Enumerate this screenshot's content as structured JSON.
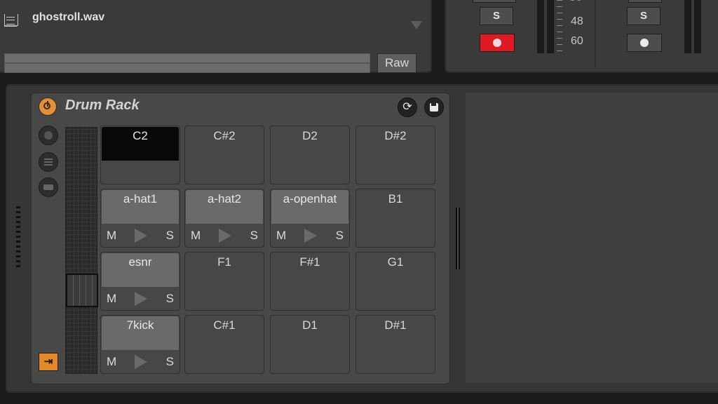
{
  "clip": {
    "sample_name": "ghostroll.wav",
    "raw_label": "Raw"
  },
  "mixer": {
    "solo_label": "S",
    "volume_marks": [
      "48",
      "60"
    ],
    "record_armed_color": "#e01a22"
  },
  "drum_rack": {
    "title": "Drum Rack",
    "hotswap_label": "⇥"
  },
  "pads": [
    {
      "note": "C2",
      "filled": false,
      "selected": true
    },
    {
      "note": "C#2",
      "filled": false,
      "selected": false
    },
    {
      "note": "D2",
      "filled": false,
      "selected": false
    },
    {
      "note": "D#2",
      "filled": false,
      "selected": false
    },
    {
      "note": "a-hat1",
      "filled": true,
      "selected": false
    },
    {
      "note": "a-hat2",
      "filled": true,
      "selected": false
    },
    {
      "note": "a-openhat",
      "filled": true,
      "selected": false
    },
    {
      "note": "B1",
      "filled": false,
      "selected": false
    },
    {
      "note": "esnr",
      "filled": true,
      "selected": false
    },
    {
      "note": "F1",
      "filled": false,
      "selected": false
    },
    {
      "note": "F#1",
      "filled": false,
      "selected": false
    },
    {
      "note": "G1",
      "filled": false,
      "selected": false
    },
    {
      "note": "7kick",
      "filled": true,
      "selected": false
    },
    {
      "note": "C#1",
      "filled": false,
      "selected": false
    },
    {
      "note": "D1",
      "filled": false,
      "selected": false
    },
    {
      "note": "D#1",
      "filled": false,
      "selected": false
    }
  ],
  "pad_controls": {
    "mute": "M",
    "solo": "S"
  },
  "colors": {
    "accent_orange": "#e0903a",
    "background": "#363636"
  }
}
